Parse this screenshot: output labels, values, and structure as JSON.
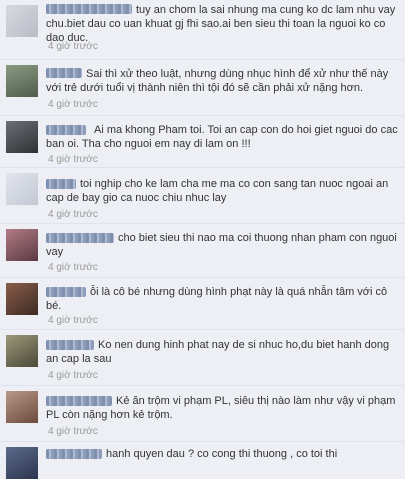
{
  "comments": [
    {
      "text": "tuy an chom la sai nhung ma cung ko dc lam nhu vay chu.biet dau co uan khuat gj fhi sao.ai ben sieu thi toan la nguoi ko co dao duc.",
      "time": "4 giờ trước"
    },
    {
      "text": "Sai thì xử theo luật, nhưng dùng nhục hình để xử như thế này với trẻ dưới tuổi vị thành niên thì tội đó sẽ cần phải xử nặng hơn.",
      "time": "4 giờ trước"
    },
    {
      "text": "Ai ma khong Pham toi. Toi an cap con do hoi giet nguoi do cac ban oi. Tha cho nguoi em nay di lam on !!!",
      "time": "4 giờ trước"
    },
    {
      "text": "toi nghip cho ke lam cha me ma co con sang tan nuoc ngoai an cap de bay gio ca nuoc chiu nhuc lay",
      "time": "4 giờ trước"
    },
    {
      "text": "cho biet sieu thi nao ma coi thuong nhan pham con nguoi vay",
      "time": "4 giờ trước"
    },
    {
      "text": "ỗi là cô bé nhưng dùng hình phạt này là quá nhẫn tâm với cô bé.",
      "time": "4 giờ trước"
    },
    {
      "text": "Ko nen dung hinh phat nay de si nhuc ho,du biet hanh dong an cap la sau",
      "time": "4 giờ trước"
    },
    {
      "text": "Kẻ ăn trộm vi phạm PL, siêu thị nào làm như vậy vi phạm PL còn nặng hơn kẻ trộm.",
      "time": "4 giờ trước"
    },
    {
      "text": "hanh quyen dau ? co cong thi thuong , co toi thi",
      "time": ""
    }
  ]
}
